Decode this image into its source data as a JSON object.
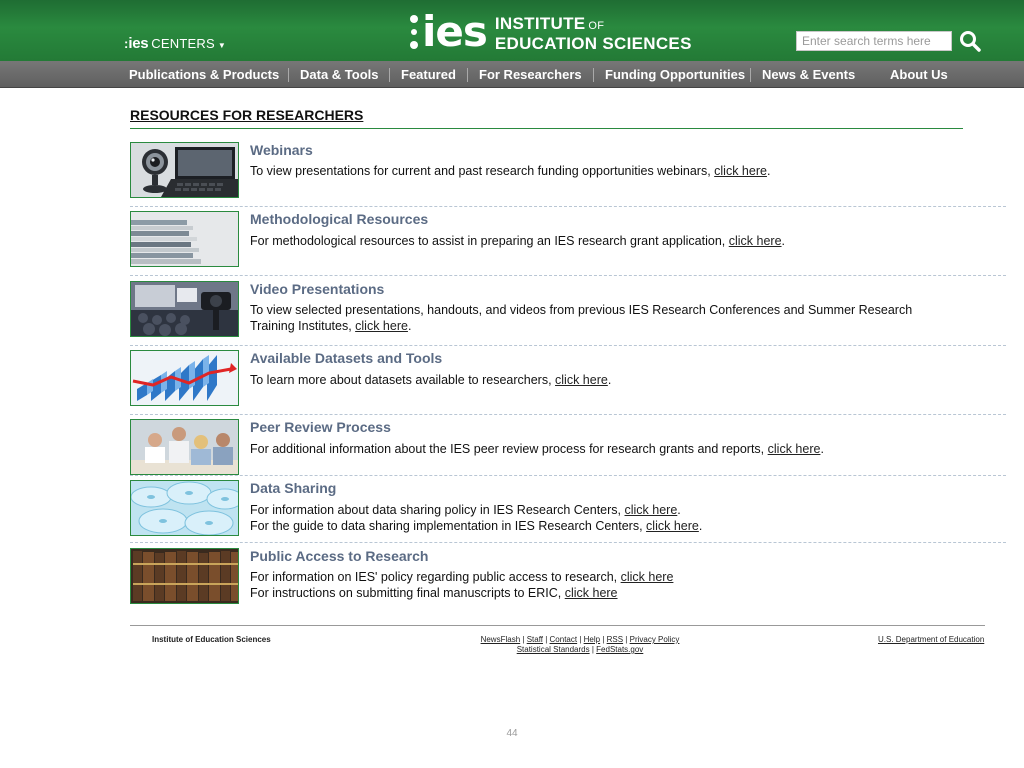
{
  "header": {
    "centers_menu": {
      "brand": "ies",
      "label": "CENTERS"
    },
    "logo": {
      "ies": "ies",
      "line1": "INSTITUTE",
      "of": "OF",
      "line2": "EDUCATION SCIENCES"
    },
    "search": {
      "placeholder": "Enter search terms here"
    }
  },
  "nav": {
    "items": [
      {
        "label": "Publications & Products"
      },
      {
        "label": "Data & Tools"
      },
      {
        "label": "Featured"
      },
      {
        "label": "For Researchers"
      },
      {
        "label": "Funding Opportunities"
      },
      {
        "label": "News & Events"
      },
      {
        "label": "About Us"
      }
    ]
  },
  "main": {
    "section_title": "RESOURCES FOR RESEARCHERS",
    "resources": [
      {
        "title": "Webinars",
        "lines": [
          {
            "text": "To view presentations for current and past research funding opportunities webinars, ",
            "link": "click here",
            "after": "."
          }
        ]
      },
      {
        "title": "Methodological Resources",
        "lines": [
          {
            "text": "For methodological resources to assist in preparing an IES research grant application, ",
            "link": "click here",
            "after": "."
          }
        ]
      },
      {
        "title": "Video Presentations",
        "lines": [
          {
            "text": "To view selected presentations, handouts, and videos from previous IES Research Conferences and Summer Research",
            "link": "",
            "after": ""
          },
          {
            "text": "Training Institutes, ",
            "link": "click here",
            "after": "."
          }
        ]
      },
      {
        "title": "Available Datasets and Tools",
        "lines": [
          {
            "text": "To learn more about datasets available to researchers, ",
            "link": "click here",
            "after": "."
          }
        ]
      },
      {
        "title": "Peer Review Process",
        "lines": [
          {
            "text": "For additional information about the IES peer review process for research grants and reports, ",
            "link": "click here",
            "after": "."
          }
        ]
      },
      {
        "title": "Data Sharing",
        "lines": [
          {
            "text": "For information about data sharing policy in IES Research Centers, ",
            "link": "click here",
            "after": "."
          },
          {
            "text": "For the guide to data sharing implementation in IES Research Centers, ",
            "link": "click here",
            "after": "."
          }
        ]
      },
      {
        "title": "Public Access to Research",
        "lines": [
          {
            "text": "For information on IES' policy regarding public access to research, ",
            "link": "click here",
            "after": ""
          },
          {
            "text": "For instructions on submitting final manuscripts to ERIC, ",
            "link": "click here",
            "after": ""
          }
        ]
      }
    ]
  },
  "footer": {
    "left": "Institute of Education Sciences",
    "links_row1": [
      "NewsFlash",
      "Staff",
      "Contact",
      "Help",
      "RSS",
      "Privacy Policy"
    ],
    "links_row2": [
      "Statistical Standards",
      "FedStats.gov"
    ],
    "separator": " | ",
    "right": "U.S. Department of Education"
  },
  "page_number": "44",
  "colors": {
    "header_green": "#2a8a3f",
    "nav_gray": "#666666",
    "title_slate": "#5b6b84"
  },
  "icons": {
    "search": "search-icon",
    "menu_caret": "caret-down-icon"
  }
}
